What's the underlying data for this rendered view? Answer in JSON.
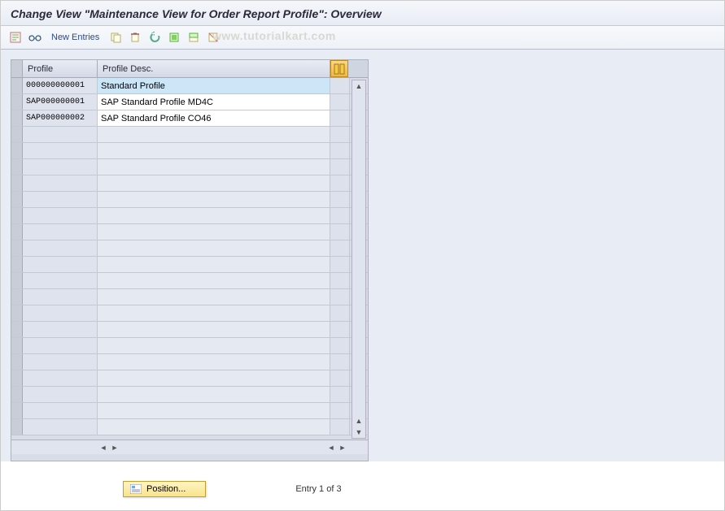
{
  "title": "Change View \"Maintenance View for Order Report Profile\": Overview",
  "watermark": "www.tutorialkart.com",
  "toolbar": {
    "new_entries": "New Entries"
  },
  "table": {
    "columns": {
      "profile": "Profile",
      "desc": "Profile Desc."
    },
    "rows": [
      {
        "profile": "000000000001",
        "desc": "Standard Profile",
        "selected": true
      },
      {
        "profile": "SAP000000001",
        "desc": "SAP Standard Profile MD4C",
        "selected": false
      },
      {
        "profile": "SAP000000002",
        "desc": "SAP Standard Profile CO46",
        "selected": false
      }
    ],
    "empty_rows": 19
  },
  "footer": {
    "position_label": "Position...",
    "entry_text": "Entry 1 of 3"
  }
}
